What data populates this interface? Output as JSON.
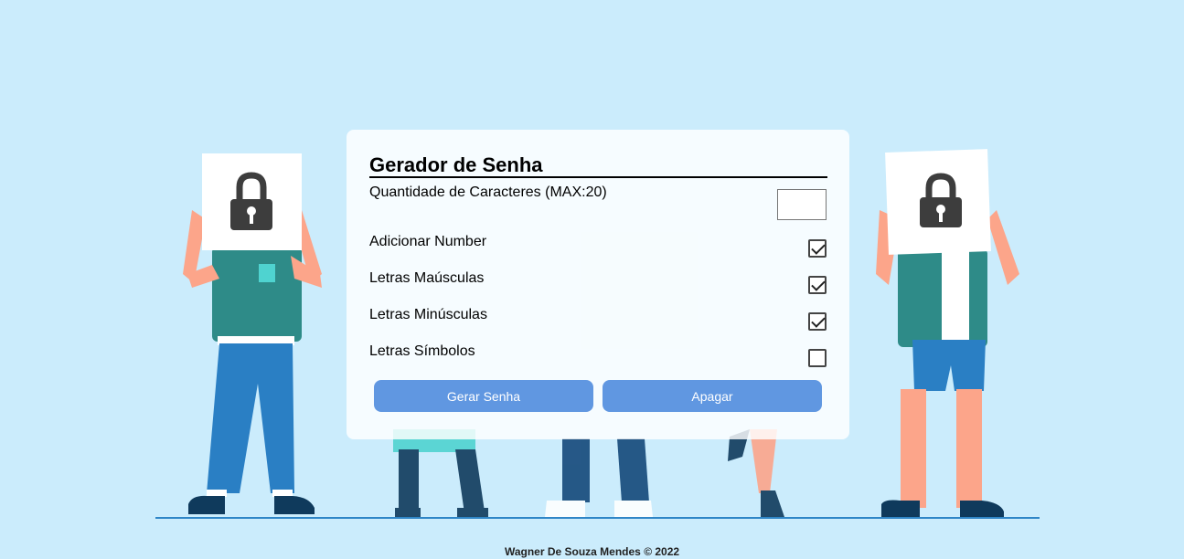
{
  "form": {
    "title": "Gerador de Senha",
    "quantity_label": "Quantidade de Caracteres (MAX:20)",
    "quantity_value": "",
    "options": [
      {
        "label": "Adicionar Number",
        "checked": true
      },
      {
        "label": "Letras Maúsculas",
        "checked": true
      },
      {
        "label": "Letras Minúsculas",
        "checked": true
      },
      {
        "label": "Letras Símbolos",
        "checked": false
      }
    ],
    "generate_label": "Gerar Senha",
    "clear_label": "Apagar"
  },
  "footer": {
    "text": "Wagner De Souza Mendes © 2022"
  },
  "colors": {
    "background": "#cbecfc",
    "button": "#6097e1",
    "shirt": "#2e8b88",
    "pants": "#2a7fc4",
    "skin": "#fca58a"
  }
}
